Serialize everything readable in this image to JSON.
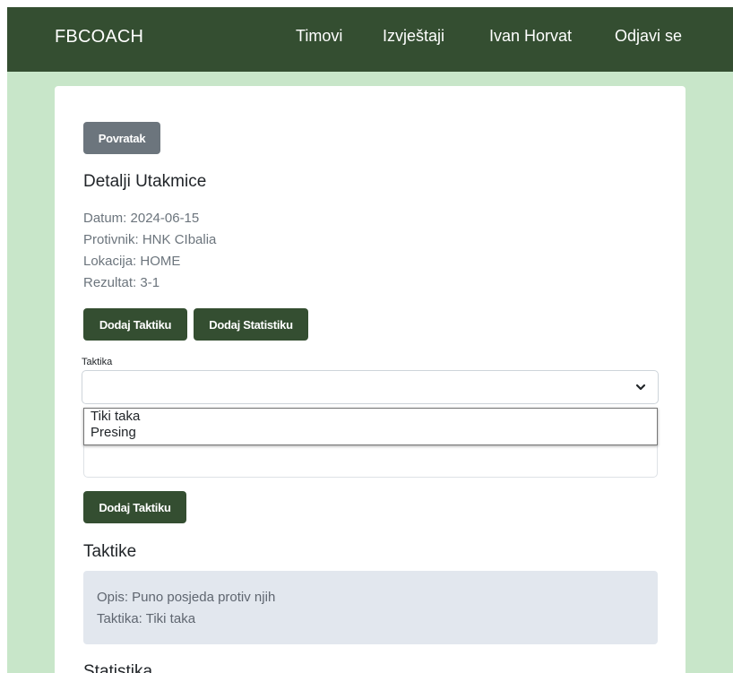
{
  "navbar": {
    "brand": "FBCOACH",
    "links": [
      "Timovi",
      "Izvještaji",
      "Ivan Horvat",
      "Odjavi se"
    ]
  },
  "match": {
    "back_label": "Povratak",
    "title": "Detalji Utakmice",
    "date_line": "Datum: 2024-06-15",
    "opponent_line": "Protivnik: HNK CIbalia",
    "location_line": "Lokacija: HOME",
    "result_line": "Rezultat: 3-1",
    "add_tactic_label": "Dodaj Taktiku",
    "add_stats_label": "Dodaj Statistiku"
  },
  "tactic_form": {
    "select_label": "Taktika",
    "select_value": "",
    "options": [
      "Tiki taka",
      "Presing"
    ],
    "submit_label": "Dodaj Taktiku"
  },
  "tactics_section": {
    "title": "Taktike",
    "items": [
      {
        "description": "Opis: Puno posjeda protiv njih",
        "tactic": "Taktika: Tiki taka"
      }
    ]
  },
  "stats_section": {
    "title": "Statistika"
  },
  "colors": {
    "navbar": "#344e31",
    "page_background": "#c8e6c9",
    "primary_button": "#344e31",
    "secondary_button": "#6c757d",
    "alert_background": "#e2e7ee"
  },
  "icons": {
    "select_chevron": "chevron-down-icon"
  }
}
